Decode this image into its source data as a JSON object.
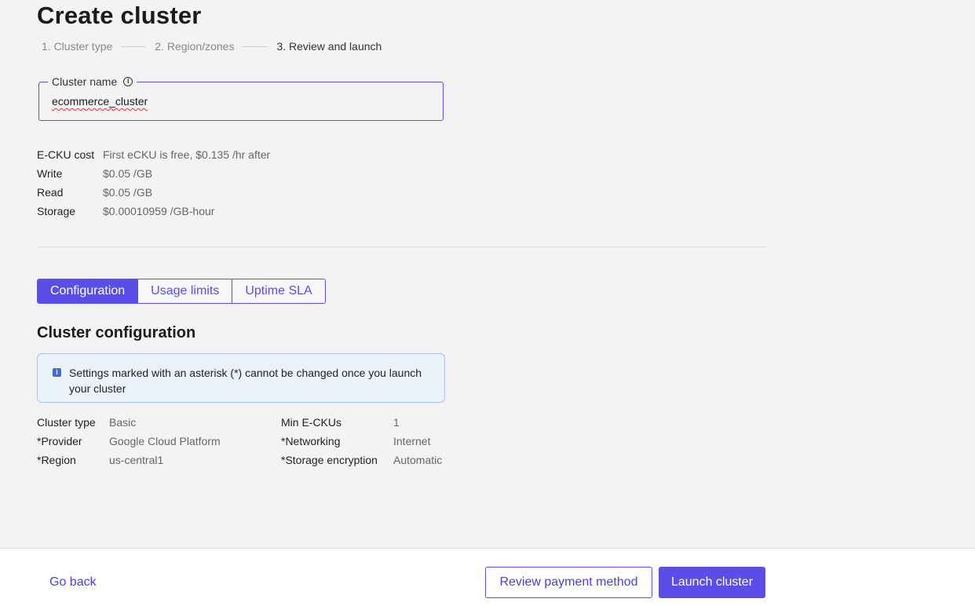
{
  "page": {
    "title": "Create cluster"
  },
  "steps": [
    {
      "label": "1. Cluster type"
    },
    {
      "label": "2. Region/zones"
    },
    {
      "label": "3. Review and launch"
    }
  ],
  "cluster_name": {
    "label": "Cluster name",
    "value": "ecommerce_cluster"
  },
  "costs": [
    {
      "label": "E-CKU cost",
      "value": "First eCKU is free, $0.135 /hr after"
    },
    {
      "label": "Write",
      "value": "$0.05 /GB"
    },
    {
      "label": "Read",
      "value": "$0.05 /GB"
    },
    {
      "label": "Storage",
      "value": "$0.00010959 /GB-hour"
    }
  ],
  "tabs": [
    {
      "label": "Configuration",
      "active": true
    },
    {
      "label": "Usage limits",
      "active": false
    },
    {
      "label": "Uptime SLA",
      "active": false
    }
  ],
  "section": {
    "title": "Cluster configuration",
    "notice": "Settings marked with an asterisk (*) cannot be changed once you launch your cluster"
  },
  "config_left": [
    {
      "label": "Cluster type",
      "value": "Basic"
    },
    {
      "label": "*Provider",
      "value": "Google Cloud Platform"
    },
    {
      "label": "*Region",
      "value": "us-central1"
    }
  ],
  "config_right": [
    {
      "label": "Min E-CKUs",
      "value": "1"
    },
    {
      "label": "*Networking",
      "value": "Internet"
    },
    {
      "label": "*Storage encryption",
      "value": "Automatic"
    }
  ],
  "footer": {
    "go_back": "Go back",
    "review_payment": "Review payment method",
    "launch": "Launch cluster"
  },
  "colors": {
    "accent": "#5b4ee8",
    "background": "#f3f3f3",
    "notice_bg": "#eaf1fb"
  }
}
